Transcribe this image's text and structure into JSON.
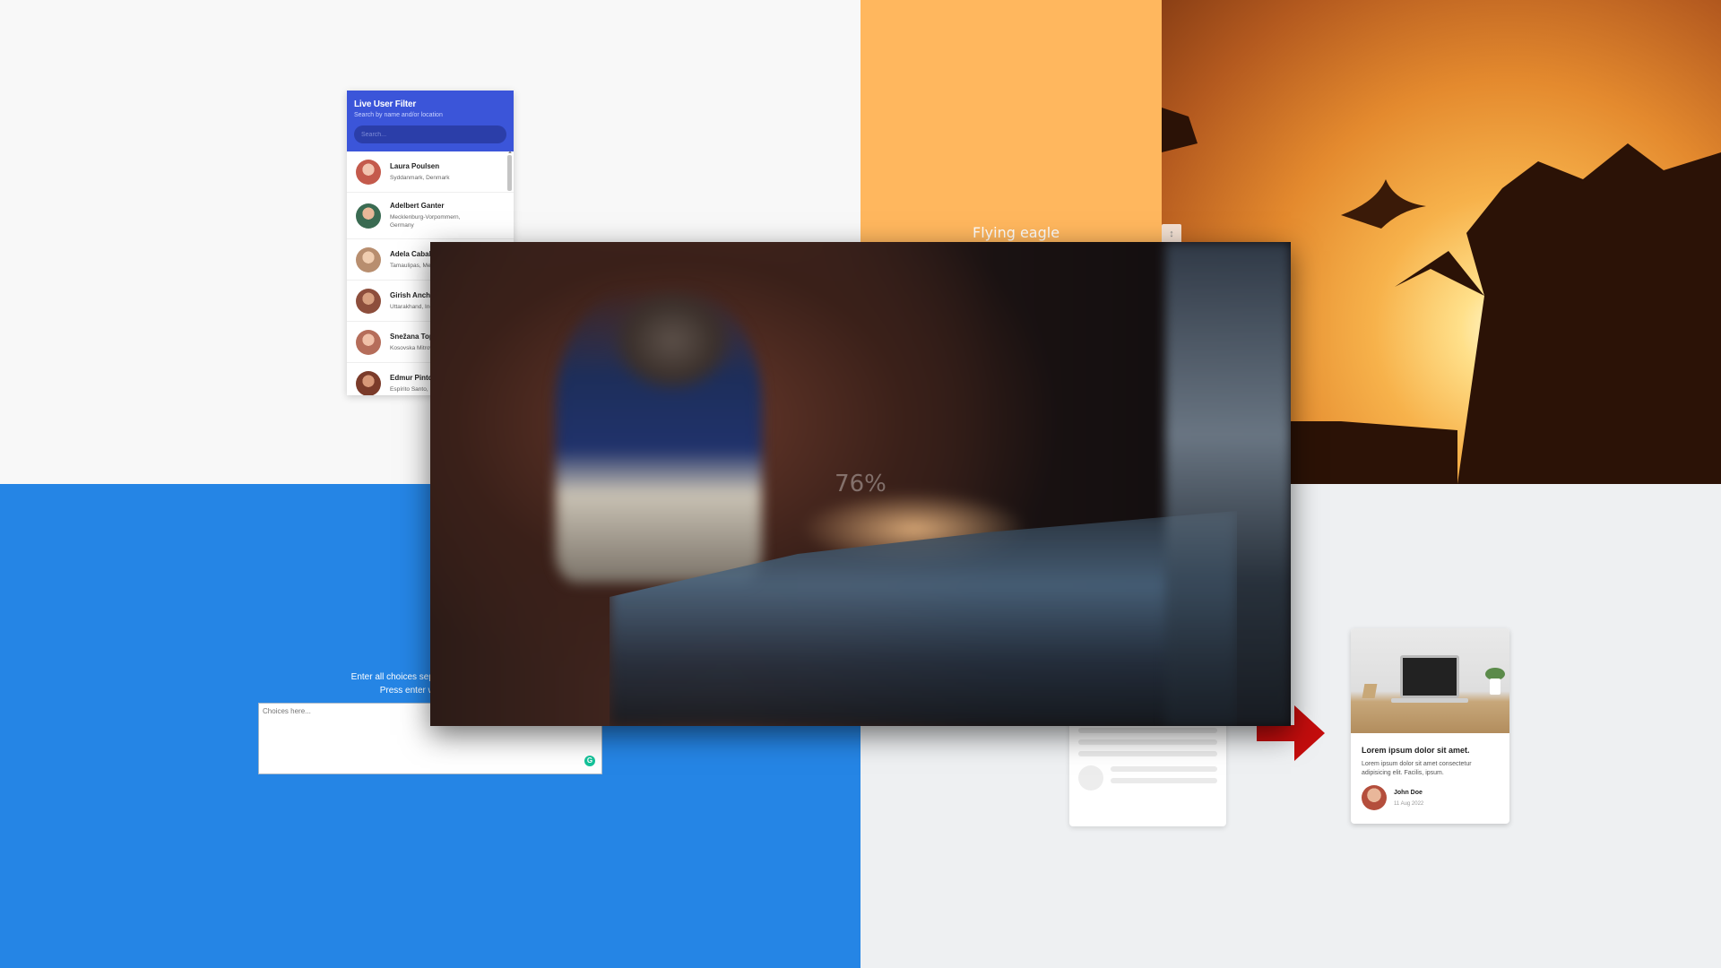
{
  "live_filter": {
    "title": "Live User Filter",
    "subtitle": "Search by name and/or location",
    "search_placeholder": "Search...",
    "users": [
      {
        "name": "Laura Poulsen",
        "location": "Syddanmark, Denmark",
        "avatar_color": "#c45a4c"
      },
      {
        "name": "Adelbert Ganter",
        "location": "Mecklenburg-Vorpommern, Germany",
        "avatar_color": "#3a6b52"
      },
      {
        "name": "Adela Caballero",
        "location": "Tamaulipas, Mexico",
        "avatar_color": "#b88e6f"
      },
      {
        "name": "Girish Anchan",
        "location": "Uttarakhand, India",
        "avatar_color": "#8d4e3c"
      },
      {
        "name": "Snežana Topalović",
        "location": "Kosovska Mitrovica, Serbia",
        "avatar_color": "#b56d5a"
      },
      {
        "name": "Edmur Pinto",
        "location": "Espírito Santo, Brazil",
        "avatar_color": "#7b3b2a"
      }
    ]
  },
  "eagle": {
    "caption": "Flying eagle"
  },
  "choices": {
    "instructions_line1": "Enter all choices separated by a comma (',').",
    "instructions_line2": "Press enter when you're done",
    "placeholder": "Choices here..."
  },
  "blog_card": {
    "title": "Lorem ipsum dolor sit amet.",
    "text": "Lorem ipsum dolor sit amet consectetur adipisicing elit. Facilis, ipsum.",
    "author": "John Doe",
    "date": "11 Aug 2022"
  },
  "overlay": {
    "progress_text": "76%",
    "progress_value": 0.76
  },
  "colors": {
    "filter_header": "#3b55d9",
    "orange_panel": "#ffb75e",
    "blue_panel": "#2585e5",
    "arrow": "#c40d0d"
  }
}
